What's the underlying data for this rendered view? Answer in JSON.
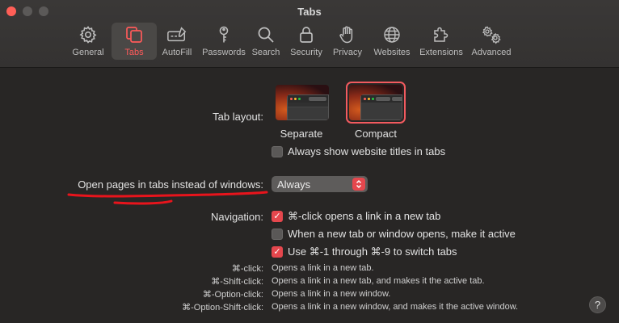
{
  "window": {
    "title": "Tabs"
  },
  "toolbar": {
    "items": [
      {
        "label": "General",
        "icon": "gear-icon",
        "active": false
      },
      {
        "label": "Tabs",
        "icon": "tabs-icon",
        "active": true
      },
      {
        "label": "AutoFill",
        "icon": "autofill-icon",
        "active": false
      },
      {
        "label": "Passwords",
        "icon": "key-icon",
        "active": false
      },
      {
        "label": "Search",
        "icon": "search-icon",
        "active": false
      },
      {
        "label": "Security",
        "icon": "lock-icon",
        "active": false
      },
      {
        "label": "Privacy",
        "icon": "hand-icon",
        "active": false
      },
      {
        "label": "Websites",
        "icon": "globe-icon",
        "active": false
      },
      {
        "label": "Extensions",
        "icon": "puzzle-icon",
        "active": false
      },
      {
        "label": "Advanced",
        "icon": "gears-icon",
        "active": false
      }
    ]
  },
  "tab_layout": {
    "label": "Tab layout:",
    "options": [
      {
        "caption": "Separate",
        "selected": false
      },
      {
        "caption": "Compact",
        "selected": true
      }
    ],
    "always_show_titles": {
      "label": "Always show website titles in tabs",
      "checked": false
    }
  },
  "open_pages": {
    "label": "Open pages in tabs instead of windows:",
    "value": "Always"
  },
  "navigation": {
    "label": "Navigation:",
    "options": [
      {
        "label": "⌘-click opens a link in a new tab",
        "checked": true
      },
      {
        "label": "When a new tab or window opens, make it active",
        "checked": false
      },
      {
        "label": "Use ⌘-1 through ⌘-9 to switch tabs",
        "checked": true
      }
    ]
  },
  "shortcuts": [
    {
      "key": "⌘-click:",
      "desc": "Opens a link in a new tab."
    },
    {
      "key": "⌘-Shift-click:",
      "desc": "Opens a link in a new tab, and makes it the active tab."
    },
    {
      "key": "⌘-Option-click:",
      "desc": "Opens a link in a new window."
    },
    {
      "key": "⌘-Option-Shift-click:",
      "desc": "Opens a link in a new window, and makes it the active window."
    }
  ],
  "help": {
    "label": "?"
  },
  "colors": {
    "accent": "#e5474d",
    "annotation": "#e8141c",
    "background": "#282625"
  }
}
